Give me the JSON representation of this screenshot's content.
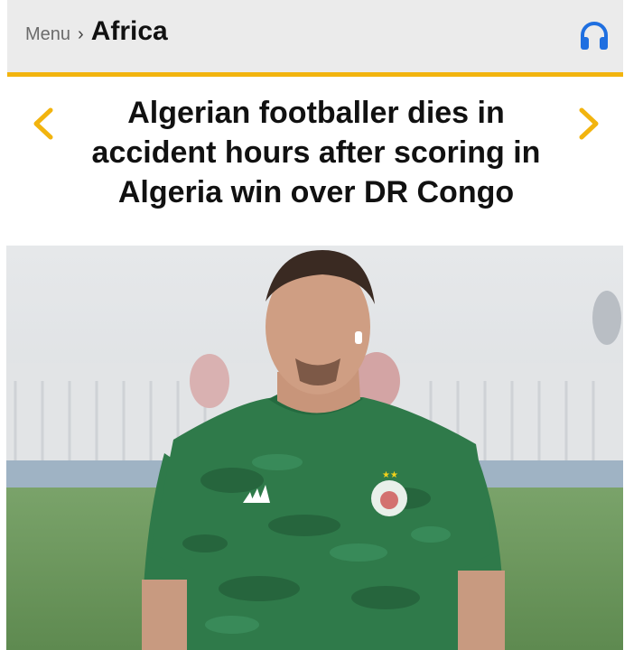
{
  "header": {
    "menu_label": "Menu",
    "separator": "›",
    "section": "Africa",
    "audio_icon": "headphones-icon",
    "accent_color": "#f2b40e",
    "icon_color": "#1f6fe0"
  },
  "article": {
    "headline": "Algerian footballer dies in accident hours after scoring in Algeria win over DR Congo",
    "prev_icon": "chevron-left-icon",
    "next_icon": "chevron-right-icon"
  },
  "photo": {
    "subject": "footballer-photo"
  }
}
